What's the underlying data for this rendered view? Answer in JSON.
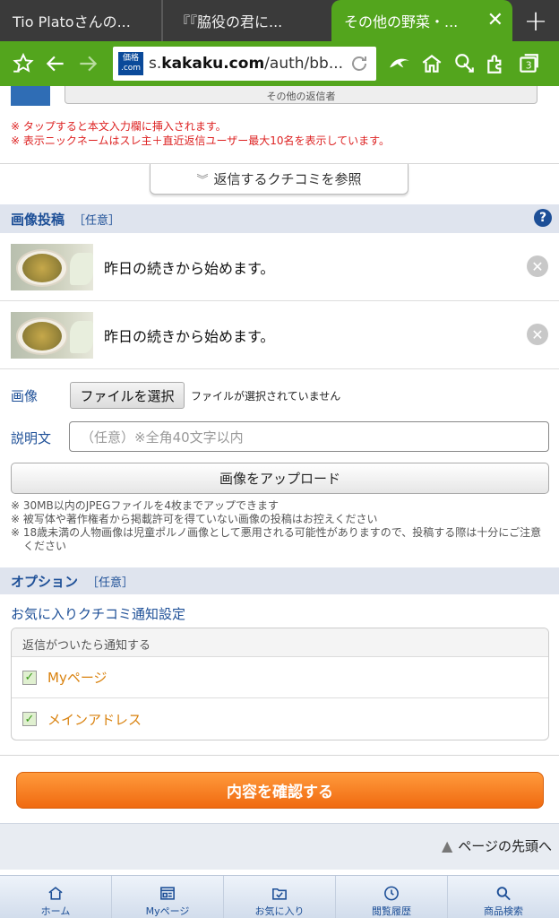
{
  "tabs": [
    {
      "label": "Tio Platoさんの..."
    },
    {
      "label": "『『脇役の君に..."
    },
    {
      "label": "その他の野菜・..."
    }
  ],
  "toolbar": {
    "url_prefix": "s.",
    "url_domain": "kakaku.com",
    "url_rest": "/auth/bb...",
    "site_logo_top": "価格",
    "site_logo_bottom": ".com",
    "tab_count": "3"
  },
  "top": {
    "other_button_label": "その他の返信者",
    "notes": [
      "※ タップすると本文入力欄に挿入されます。",
      "※ 表示ニックネームはスレ主＋直近返信ユーザー最大10名を表示しています。"
    ],
    "reference_button": "返信するクチコミを参照"
  },
  "image_section": {
    "title": "画像投稿",
    "optional": "［任意］",
    "help": "?",
    "rows": [
      {
        "text": "昨日の続きから始めます。"
      },
      {
        "text": "昨日の続きから始めます。"
      }
    ],
    "image_label": "画像",
    "file_button": "ファイルを選択",
    "file_status": "ファイルが選択されていません",
    "desc_label": "説明文",
    "desc_placeholder": "（任意）※全角40文字以内",
    "upload_button": "画像をアップロード",
    "notes": [
      "※ 30MB以内のJPEGファイルを4枚までアップできます",
      "※ 被写体や著作権者から掲載許可を得ていない画像の投稿はお控えください",
      "※ 18歳未満の人物画像は児童ポルノ画像として悪用される可能性がありますので、投稿する際は十分にご注意ください"
    ]
  },
  "options_section": {
    "title": "オプション",
    "optional": "［任意］",
    "fav_title": "お気に入りクチコミ通知設定",
    "fav_head": "返信がついたら通知する",
    "items": [
      {
        "label": "Myページ",
        "checked": true
      },
      {
        "label": "メインアドレス",
        "checked": true
      }
    ]
  },
  "confirm_button": "内容を確認する",
  "page_top": "ページの先頭へ",
  "bottom_nav": [
    {
      "label": "ホーム",
      "icon": "home-icon"
    },
    {
      "label": "Myページ",
      "icon": "mypage-icon"
    },
    {
      "label": "お気に入り",
      "icon": "favorite-icon"
    },
    {
      "label": "閲覧履歴",
      "icon": "history-icon"
    },
    {
      "label": "商品検索",
      "icon": "search-icon"
    }
  ],
  "colors": {
    "browser_green": "#53a51d",
    "link_blue": "#1d4f97",
    "warning_red": "#dd2222",
    "accent_orange": "#f06a10"
  }
}
